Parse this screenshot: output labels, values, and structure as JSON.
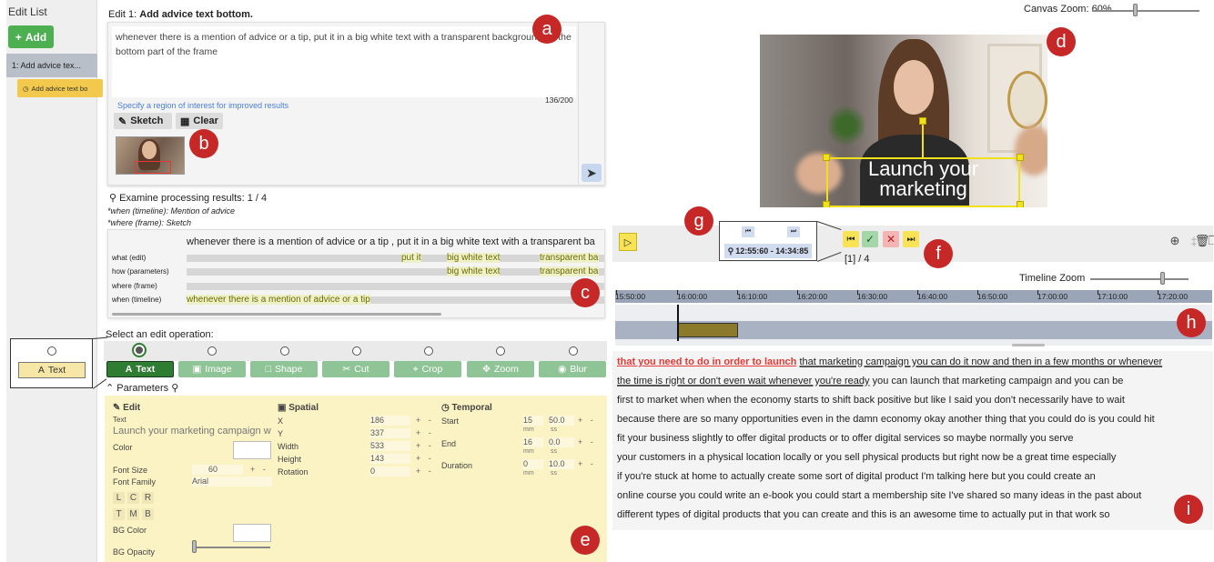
{
  "sidebar": {
    "title": "Edit List",
    "add_label": "Add",
    "item_label": "1: Add advice tex...",
    "chip_label": "Add advice text bo"
  },
  "callouts": {
    "a": "a",
    "b": "b",
    "c": "c",
    "d": "d",
    "e": "e",
    "f": "f",
    "g": "g",
    "h": "h",
    "i": "i"
  },
  "edit": {
    "heading_prefix": "Edit 1:",
    "heading_title": "Add advice text bottom.",
    "prompt": "whenever there is a mention of advice or a tip, put it in a big white text with a transparent background on the bottom part of the frame",
    "char_count": "136/200",
    "hint": "Specify a region of interest for improved results",
    "sketch_label": "Sketch",
    "clear_label": "Clear"
  },
  "examine": {
    "title": "Examine processing results: 1 / 4",
    "when_note": "*when (timeline): Mention of advice",
    "where_note": "*where (frame): Sketch",
    "query": "whenever there is a mention of advice or a tip , put it in a big white text with a transparent ba",
    "rows": [
      "what (edit)",
      "how (parameters)",
      "where (frame)",
      "when (timeline)"
    ],
    "what_tokens": [
      "put it",
      "big white text",
      "transparent ba"
    ],
    "how_tokens": [
      "big white text",
      "transparent ba"
    ],
    "when_tokens": [
      "whenever there is a mention of advice or a tip"
    ]
  },
  "operations": {
    "title": "Select an edit operation:",
    "items": [
      "Text",
      "Image",
      "Shape",
      "Cut",
      "Crop",
      "Zoom",
      "Blur"
    ],
    "selected": "Text"
  },
  "inset": {
    "label": "Text"
  },
  "parameters": {
    "heading": "Parameters",
    "edit_section": "Edit",
    "spatial_section": "Spatial",
    "temporal_section": "Temporal",
    "text_label": "Text",
    "text_value": "Launch your marketing campaign w",
    "color_label": "Color",
    "font_size_label": "Font Size",
    "font_size_value": "60",
    "font_family_label": "Font Family",
    "font_family_value": "Arial",
    "align_h": [
      "L",
      "C",
      "R"
    ],
    "align_v": [
      "T",
      "M",
      "B"
    ],
    "bg_color_label": "BG Color",
    "bg_opacity_label": "BG Opacity",
    "spatial": [
      {
        "label": "X",
        "value": "186"
      },
      {
        "label": "Y",
        "value": "337"
      },
      {
        "label": "Width",
        "value": "533"
      },
      {
        "label": "Height",
        "value": "143"
      },
      {
        "label": "Rotation",
        "value": "0"
      }
    ],
    "temporal": [
      {
        "label": "Start",
        "mm": "15",
        "ss": "50.0"
      },
      {
        "label": "End",
        "mm": "16",
        "ss": "0.0"
      },
      {
        "label": "Duration",
        "mm": "0",
        "ss": "10.0"
      }
    ],
    "mm_unit": "mm",
    "ss_unit": "ss",
    "plus_minus": "+ -"
  },
  "canvas": {
    "zoom_label": "Canvas Zoom: 60%",
    "overlay_text_1": "Launch your",
    "overlay_text_2": "marketing"
  },
  "playback": {
    "count": "[1] / 4",
    "time_range": "12:55:60 - 14:34:85"
  },
  "timeline": {
    "zoom_label": "Timeline Zoom",
    "ticks": [
      "15:50:00",
      "16:00:00",
      "16:10:00",
      "16:20:00",
      "16:30:00",
      "16:40:00",
      "16:50:00",
      "17:00:00",
      "17:10:00",
      "17:20:00"
    ]
  },
  "transcript": {
    "line1_hl": "that you need to do in order to launch",
    "line1_rest": "that marketing campaign you can do it  now and then in a few months or whenever",
    "line2_ul": "the time is right or don't even wait  whenever you're ready",
    "line2_rest": " you can launch  that marketing campaign and you can be",
    "lines": [
      "first to market when when the economy  starts to shift back positive but like I  said you don't necessarily have to wait",
      "because there are so many opportunities  even in the damn economy okay another  thing that you could do is you could hit",
      "fit your business slightly to offer  digital products or to offer digital  services so maybe normally you serve",
      "your customers in a physical location  locally or you sell physical products  but right now be a great time especially",
      "if you're stuck at home to actually  create some sort of digital product I'm  talking here but you could create an",
      "online course you could write an e-book  you could start a membership site I've  shared so many ideas in the past about",
      "different types of digital products that  you can create and this is an awesome  time to actually put in that work so"
    ]
  },
  "colors": {
    "accent_green": "#2e7d32",
    "callout_red": "#c62828",
    "param_bg": "#fbf3c4",
    "selection_yellow": "#f1e01c"
  }
}
